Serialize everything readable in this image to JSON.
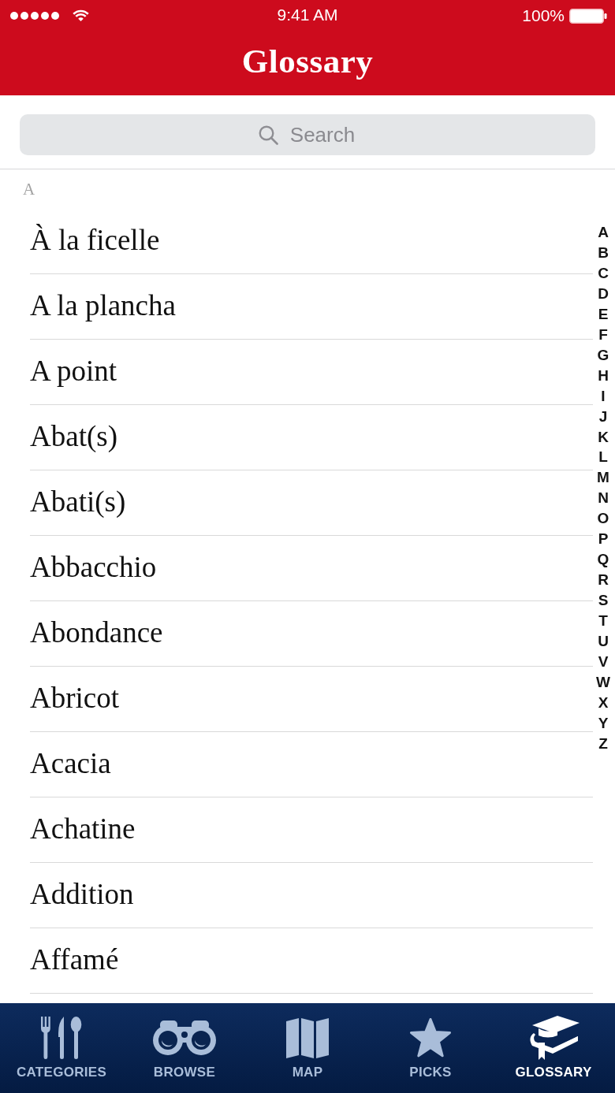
{
  "status_bar": {
    "time": "9:41 AM",
    "battery": "100%"
  },
  "header": {
    "title": "Glossary"
  },
  "search": {
    "placeholder": "Search"
  },
  "section": {
    "title": "A",
    "items": [
      "À la ficelle",
      "A la plancha",
      "A point",
      "Abat(s)",
      "Abati(s)",
      "Abbacchio",
      "Abondance",
      "Abricot",
      "Acacia",
      "Achatine",
      "Addition",
      "Affamé"
    ]
  },
  "index_letters": [
    "A",
    "B",
    "C",
    "D",
    "E",
    "F",
    "G",
    "H",
    "I",
    "J",
    "K",
    "L",
    "M",
    "N",
    "O",
    "P",
    "Q",
    "R",
    "S",
    "T",
    "U",
    "V",
    "W",
    "X",
    "Y",
    "Z"
  ],
  "tab_bar": [
    {
      "label": "CATEGORIES",
      "selected": false
    },
    {
      "label": "BROWSE",
      "selected": false
    },
    {
      "label": "MAP",
      "selected": false
    },
    {
      "label": "PICKS",
      "selected": false
    },
    {
      "label": "GLOSSARY",
      "selected": true
    }
  ]
}
